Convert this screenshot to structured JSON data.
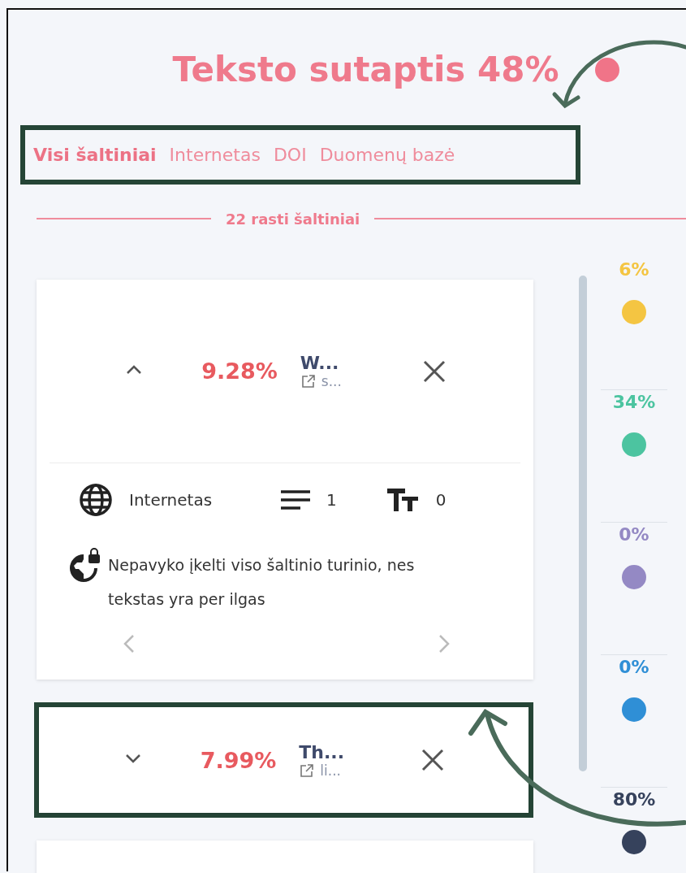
{
  "title": "Teksto sutaptis 48%",
  "tabs": [
    {
      "label": "Visi šaltiniai",
      "selected": true
    },
    {
      "label": "Internetas",
      "selected": false
    },
    {
      "label": "DOI",
      "selected": false
    },
    {
      "label": "Duomenų bazė",
      "selected": false
    }
  ],
  "sources_count": "22 rasti šaltiniai",
  "sources": [
    {
      "expanded": true,
      "percent": "9.28%",
      "name": "W...",
      "link": "s...",
      "type": "Internetas",
      "paragraphs": "1",
      "words": "0",
      "message": "Nepavyko įkelti viso šaltinio turinio, nes tekstas yra per ilgas",
      "highlighted": false
    },
    {
      "expanded": false,
      "percent": "7.99%",
      "name": "Th...",
      "link": "li...",
      "highlighted": true
    }
  ],
  "legend": [
    {
      "value": "6%",
      "color": "#f4c542"
    },
    {
      "value": "34%",
      "color": "#4cc4a0"
    },
    {
      "value": "0%",
      "color": "#9489c4"
    },
    {
      "value": "0%",
      "color": "#2f8fd6"
    },
    {
      "value": "80%",
      "color": "#36425c"
    }
  ]
}
